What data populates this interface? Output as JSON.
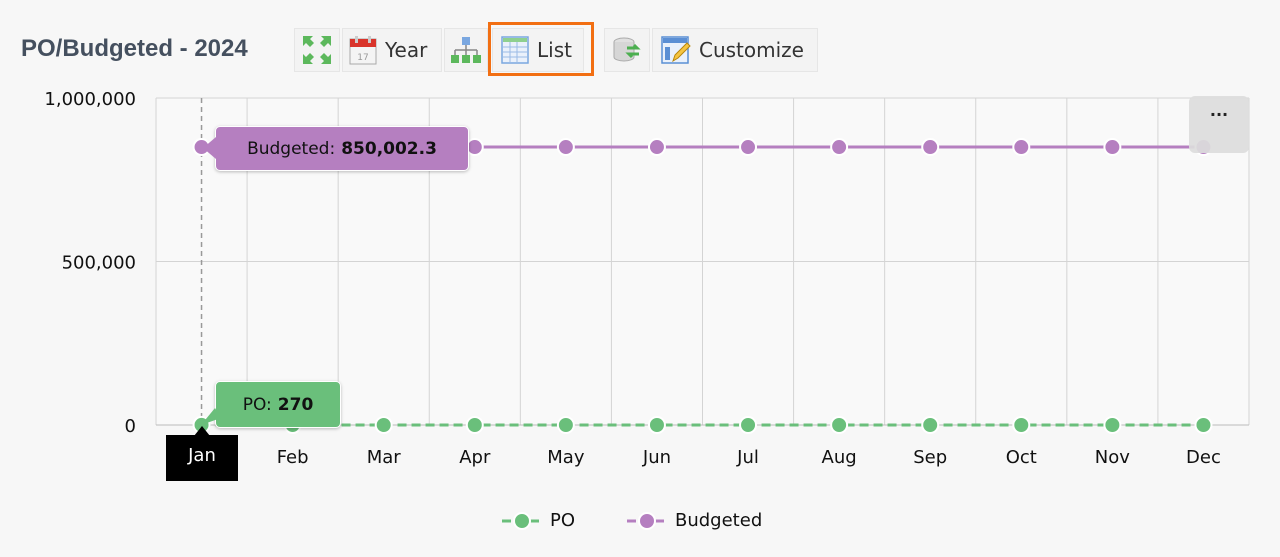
{
  "header": {
    "title": "PO/Budgeted - 2024",
    "toolbar": [
      {
        "icon": "expand-icon",
        "label": ""
      },
      {
        "icon": "calendar-icon",
        "label": "Year"
      },
      {
        "icon": "hierarchy-icon",
        "label": ""
      },
      {
        "icon": "list-table-icon",
        "label": "List",
        "highlighted": true
      },
      {
        "icon": "refresh-database-icon",
        "label": ""
      },
      {
        "icon": "customize-icon",
        "label": "Customize"
      }
    ]
  },
  "more_button": {
    "label": "..."
  },
  "tooltips": {
    "budgeted": {
      "label": "Budgeted:",
      "value": "850,002.3"
    },
    "po": {
      "label": "PO:",
      "value": "270"
    },
    "x_label": "Jan"
  },
  "colors": {
    "po": "#6abf7b",
    "budgeted": "#b57fc0",
    "highlight": "#f26f13"
  },
  "chart_data": {
    "type": "line",
    "title": "PO/Budgeted - 2024",
    "xlabel": "",
    "ylabel": "",
    "categories": [
      "Jan",
      "Feb",
      "Mar",
      "Apr",
      "May",
      "Jun",
      "Jul",
      "Aug",
      "Sep",
      "Oct",
      "Nov",
      "Dec"
    ],
    "series": [
      {
        "name": "PO",
        "values": [
          270,
          0,
          0,
          0,
          0,
          0,
          0,
          0,
          0,
          0,
          0,
          0
        ]
      },
      {
        "name": "Budgeted",
        "values": [
          850002.3,
          850002.3,
          850002.3,
          850002.3,
          850002.3,
          850002.3,
          850002.3,
          850002.3,
          850002.3,
          850002.3,
          850002.3,
          850002.3
        ]
      }
    ],
    "ylim": [
      0,
      1000000
    ],
    "yticks": [
      0,
      500000,
      1000000
    ],
    "ytick_labels": [
      "0",
      "500,000",
      "1,000,000"
    ],
    "grid": true,
    "legend": "bottom-center",
    "hovered_category": "Jan"
  }
}
